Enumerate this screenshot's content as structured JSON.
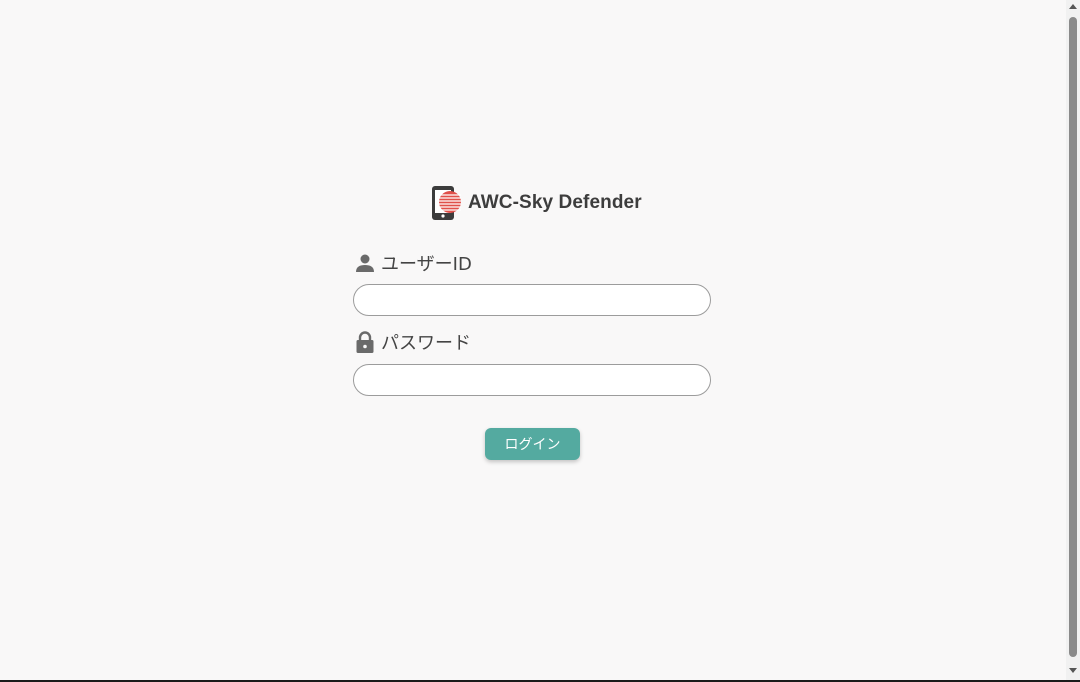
{
  "brand": {
    "title": "AWC-Sky Defender",
    "icon": "phone-shield-icon"
  },
  "form": {
    "user_id": {
      "label": "ユーザーID",
      "icon": "person-icon",
      "value": "",
      "placeholder": ""
    },
    "password": {
      "label": "パスワード",
      "icon": "lock-icon",
      "value": "",
      "placeholder": ""
    },
    "submit_label": "ログイン"
  },
  "colors": {
    "background": "#f9f8f8",
    "accent": "#54aaa0",
    "logo_red": "#e0504a",
    "text": "#444444"
  }
}
